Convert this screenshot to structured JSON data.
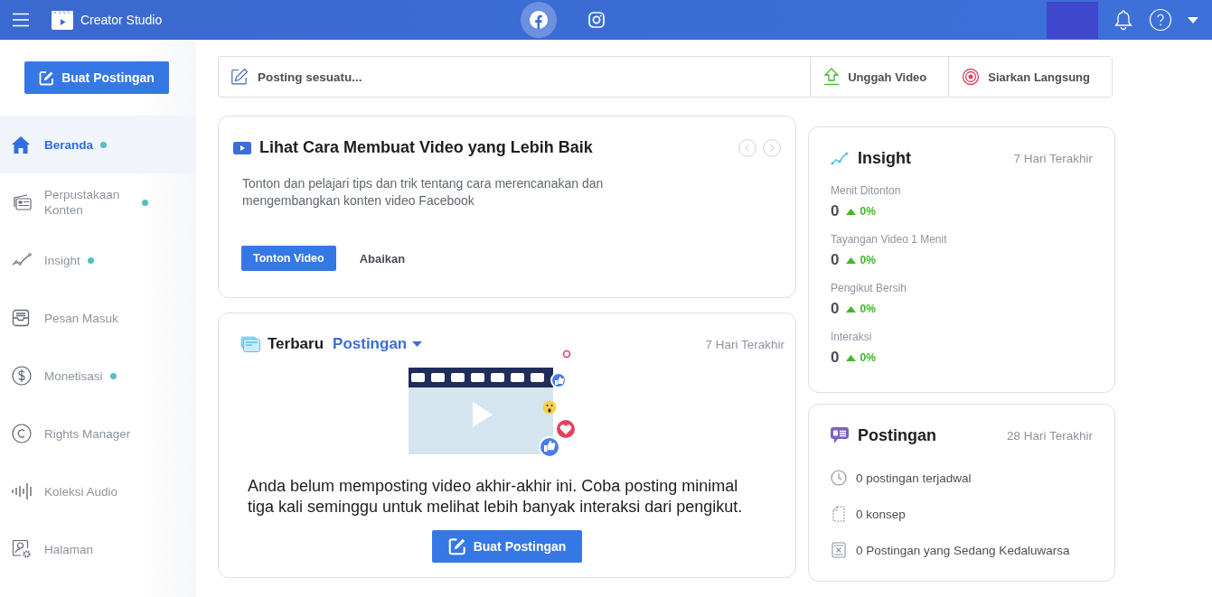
{
  "topbar": {
    "app_name": "Creator Studio",
    "platforms": [
      {
        "kind": "facebook",
        "selected": true
      },
      {
        "kind": "instagram",
        "selected": false
      }
    ]
  },
  "sidebar": {
    "create_button": "Buat Postingan",
    "items": [
      {
        "kind": "home",
        "label": "Beranda",
        "selected": true,
        "dot": true
      },
      {
        "kind": "library",
        "label": "Perpustakaan Konten",
        "selected": false,
        "dot": true
      },
      {
        "kind": "insight",
        "label": "Insight",
        "selected": false,
        "dot": true
      },
      {
        "kind": "inbox",
        "label": "Pesan Masuk",
        "selected": false,
        "dot": false
      },
      {
        "kind": "money",
        "label": "Monetisasi",
        "selected": false,
        "dot": true
      },
      {
        "kind": "rights",
        "label": "Rights Manager",
        "selected": false,
        "dot": false
      },
      {
        "kind": "audio",
        "label": "Koleksi Audio",
        "selected": false,
        "dot": false
      },
      {
        "kind": "pages",
        "label": "Halaman",
        "selected": false,
        "dot": false
      }
    ]
  },
  "composer": {
    "placeholder": "Posting sesuatu...",
    "actions": [
      {
        "kind": "upload",
        "label": "Unggah Video"
      },
      {
        "kind": "live",
        "label": "Siarkan Langsung"
      }
    ]
  },
  "tips_card": {
    "title": "Lihat Cara Membuat Video yang Lebih Baik",
    "description": "Tonton dan pelajari tips dan trik tentang cara merencanakan dan mengembangkan konten video Facebook",
    "primary_button": "Tonton Video",
    "secondary_button": "Abaikan"
  },
  "recent_card": {
    "title": "Terbaru",
    "filter": "Postingan",
    "period": "7 Hari Terakhir",
    "message": "Anda belum memposting video akhir-akhir ini. Coba posting minimal tiga kali seminggu untuk melihat lebih banyak interaksi dari pengikut.",
    "button": "Buat Postingan"
  },
  "insight_card": {
    "title": "Insight",
    "period": "7 Hari Terakhir",
    "stats": [
      {
        "label": "Menit Ditonton",
        "value": "0",
        "change": "0%"
      },
      {
        "label": "Tayangan Video 1 Menit",
        "value": "0",
        "change": "0%"
      },
      {
        "label": "Pengikut Bersih",
        "value": "0",
        "change": "0%"
      },
      {
        "label": "Interaksi",
        "value": "0",
        "change": "0%"
      }
    ]
  },
  "posts_card": {
    "title": "Postingan",
    "period": "28 Hari Terakhir",
    "items": [
      {
        "kind": "scheduled",
        "text": "0 postingan terjadwal"
      },
      {
        "kind": "draft",
        "text": "0 konsep"
      },
      {
        "kind": "expiring",
        "text": "0 Postingan yang Sedang Kedaluwarsa"
      }
    ]
  }
}
